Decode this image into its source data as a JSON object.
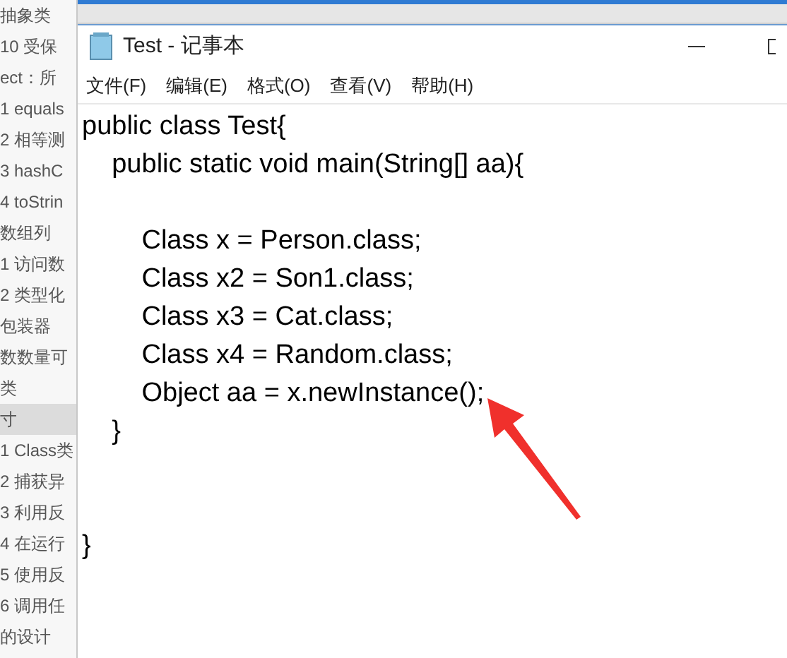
{
  "background_outline": {
    "items": [
      {
        "text": "抽象类",
        "selected": false
      },
      {
        "text": "10 受保",
        "selected": false
      },
      {
        "text": "ect：所",
        "selected": false
      },
      {
        "text": "1 equals",
        "selected": false
      },
      {
        "text": "2 相等测",
        "selected": false
      },
      {
        "text": "3 hashC",
        "selected": false
      },
      {
        "text": "4 toStrin",
        "selected": false
      },
      {
        "text": "数组列",
        "selected": false
      },
      {
        "text": "1 访问数",
        "selected": false
      },
      {
        "text": "2 类型化",
        "selected": false
      },
      {
        "text": "包装器",
        "selected": false
      },
      {
        "text": "数数量可",
        "selected": false
      },
      {
        "text": "类",
        "selected": false
      },
      {
        "text": "寸",
        "selected": true
      },
      {
        "text": "1 Class类",
        "selected": false
      },
      {
        "text": "2 捕获异",
        "selected": false
      },
      {
        "text": "3 利用反",
        "selected": false
      },
      {
        "text": "4 在运行",
        "selected": false
      },
      {
        "text": "5 使用反",
        "selected": false
      },
      {
        "text": "6 调用任",
        "selected": false
      },
      {
        "text": "的设计",
        "selected": false
      }
    ]
  },
  "window": {
    "title": "Test - 记事本"
  },
  "menu": [
    "文件(F)",
    "编辑(E)",
    "格式(O)",
    "查看(V)",
    "帮助(H)"
  ],
  "editor": {
    "lines": [
      {
        "text": "public class Test{",
        "kind": "plain"
      },
      {
        "text": "    public static void main(String[] aa){",
        "kind": "plain"
      },
      {
        "text": "        Class x = Person.class;",
        "kind": "after_blank"
      },
      {
        "text": "        Class x2 = Son1.class;",
        "kind": "plain"
      },
      {
        "text": "        Class x3 = Cat.class;",
        "kind": "plain"
      },
      {
        "text": "        Class x4 = Random.class;",
        "kind": "plain"
      },
      {
        "text": "        Object aa = x.newInstance();",
        "kind": "plain"
      },
      {
        "text": "    }",
        "kind": "plain"
      },
      {
        "text": "}",
        "kind": "after_two_blanks"
      }
    ]
  }
}
